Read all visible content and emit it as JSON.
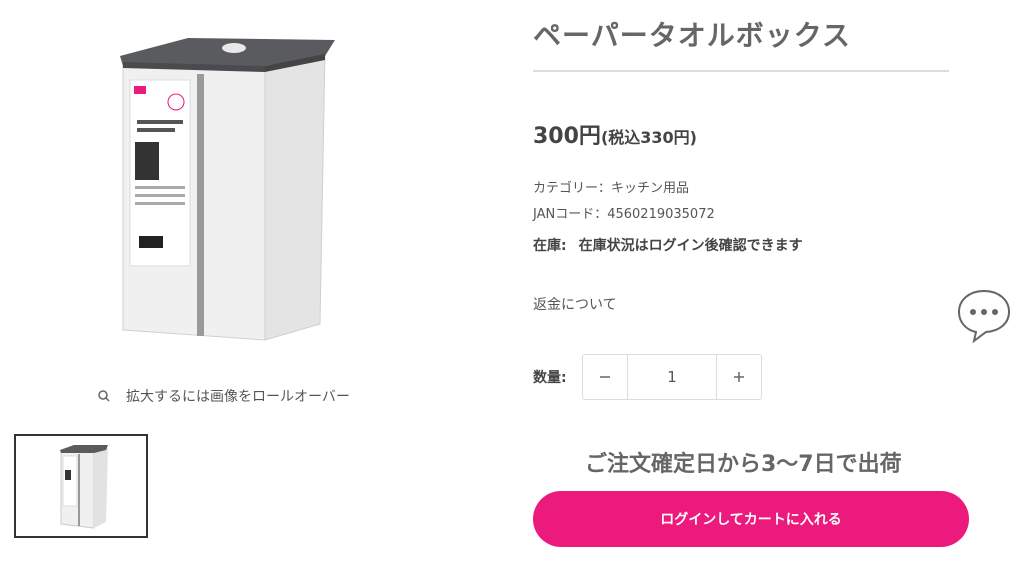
{
  "product": {
    "title": "ペーパータオルボックス",
    "price_main": "300円",
    "price_tax": "(税込330円)",
    "category": "カテゴリー：キッチン用品",
    "jan": "JANコード：4560219035072",
    "stock_label": "在庫:",
    "stock_value": "在庫状況はログイン後確認できます",
    "refund_link": "返金について",
    "quantity_label": "数量:",
    "quantity_value": "1",
    "shipping_note": "ご注文確定日から3〜7日で出荷",
    "cart_button": "ログインしてカートに入れる"
  },
  "gallery": {
    "zoom_hint": "拡大するには画像をロールオーバー",
    "package_label_title": "ペーパータオルボックス",
    "package_price_badge": "300円",
    "brand_logo": "daiso"
  },
  "icons": {
    "zoom": "magnifier-icon",
    "minus": "minus-icon",
    "plus": "plus-icon",
    "chat": "speech-bubble-icon"
  },
  "colors": {
    "accent": "#ec1a7d",
    "lid": "#5a5b5e",
    "box": "#f2f2f2"
  }
}
